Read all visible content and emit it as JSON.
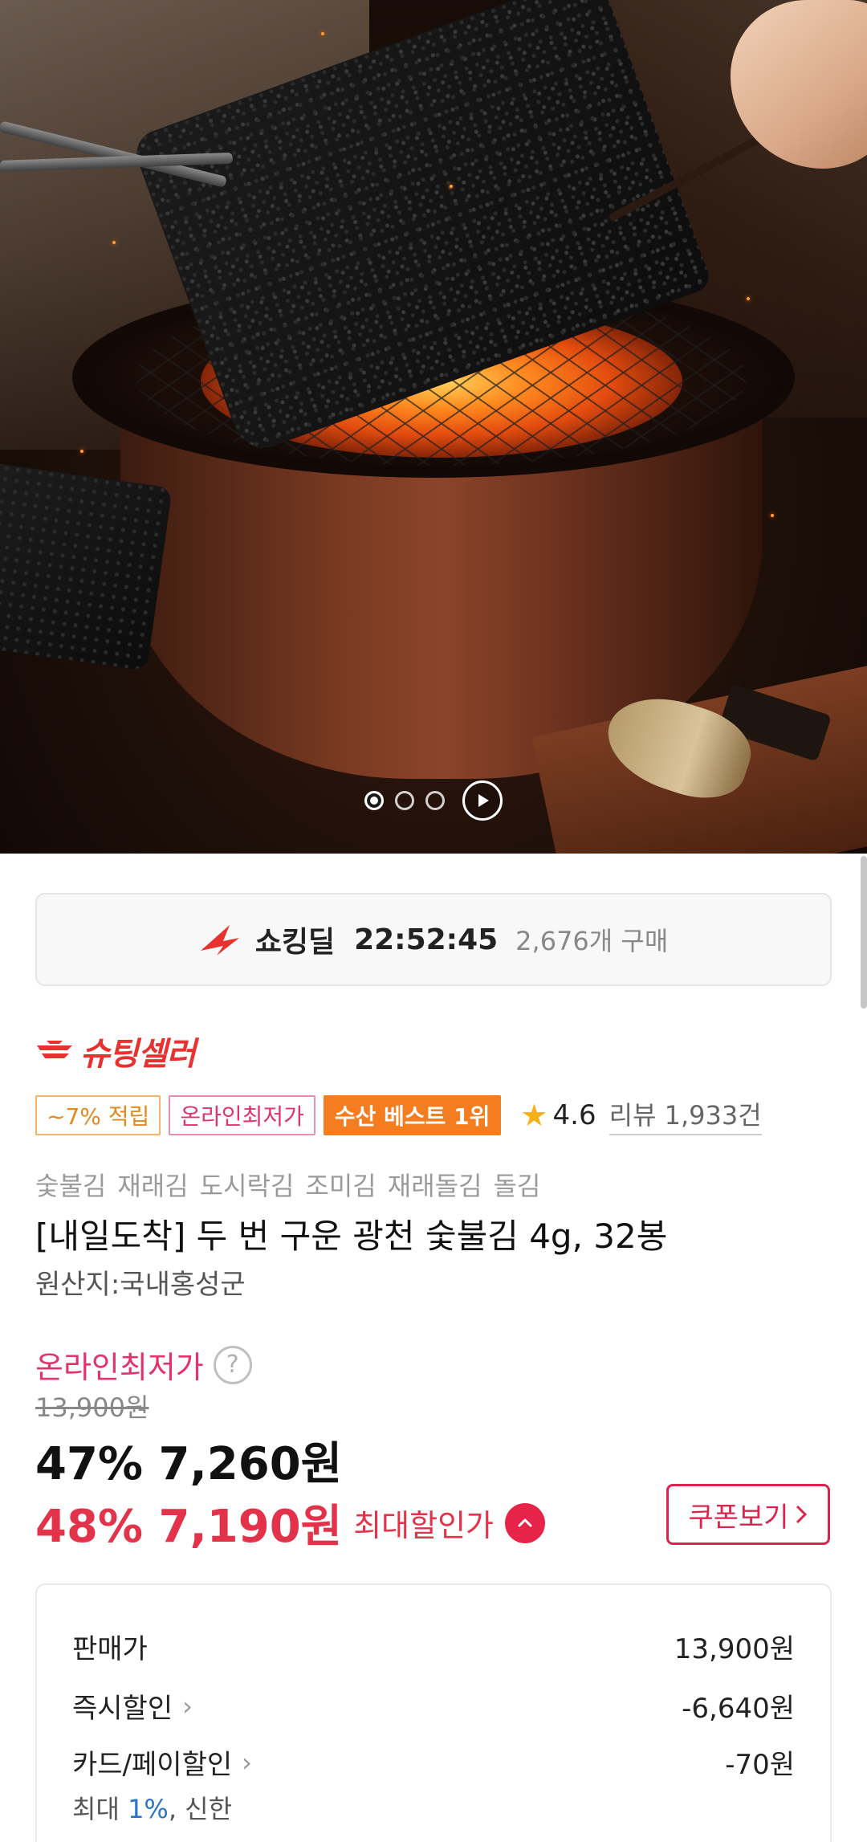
{
  "hero": {
    "image_alt": "Grilled laver over charcoal brazier",
    "carousel": {
      "total": 3,
      "active_index": 0,
      "play_icon": "play-icon"
    }
  },
  "deal": {
    "icon": "lightning-deal-icon",
    "name": "쇼킹딜",
    "timer": "22:52:45",
    "purchase_count": "2,676개 구매"
  },
  "seller": {
    "name": "슈팅셀러",
    "icon": "wings-icon"
  },
  "badges": {
    "cashback": "~7% 적립",
    "lowest": "온라인최저가",
    "best": "수산 베스트 1위"
  },
  "rating": {
    "score": "4.6",
    "review_label": "리뷰",
    "review_count": "1,933건"
  },
  "product": {
    "keywords": [
      "숯불김",
      "재래김",
      "도시락김",
      "조미김",
      "재래돌김",
      "돌김"
    ],
    "title": "[내일도착] 두 번 구운 광천 숯불김 4g, 32봉",
    "origin": "원산지:국내홍성군"
  },
  "pricing": {
    "lowest_label": "온라인최저가",
    "help_glyph": "?",
    "original_price": "13,900원",
    "discount1": "47% 7,260원",
    "discount2": "48% 7,190원",
    "max_discount_label": "최대할인가",
    "coupon_button": "쿠폰보기"
  },
  "breakdown": {
    "rows": [
      {
        "label": "판매가",
        "value": "13,900원",
        "has_chevron": false
      },
      {
        "label": "즉시할인",
        "value": "-6,640원",
        "has_chevron": true
      },
      {
        "label": "카드/페이할인",
        "value": "-70원",
        "has_chevron": true
      }
    ],
    "card_sub_prefix": "최대 ",
    "card_sub_highlight": "1%",
    "card_sub_suffix": ", 신한"
  },
  "colors": {
    "accent_red": "#e2334a",
    "lowest_pink": "#e2336a",
    "best_orange": "#f57c1f",
    "star": "#f6b01b"
  }
}
